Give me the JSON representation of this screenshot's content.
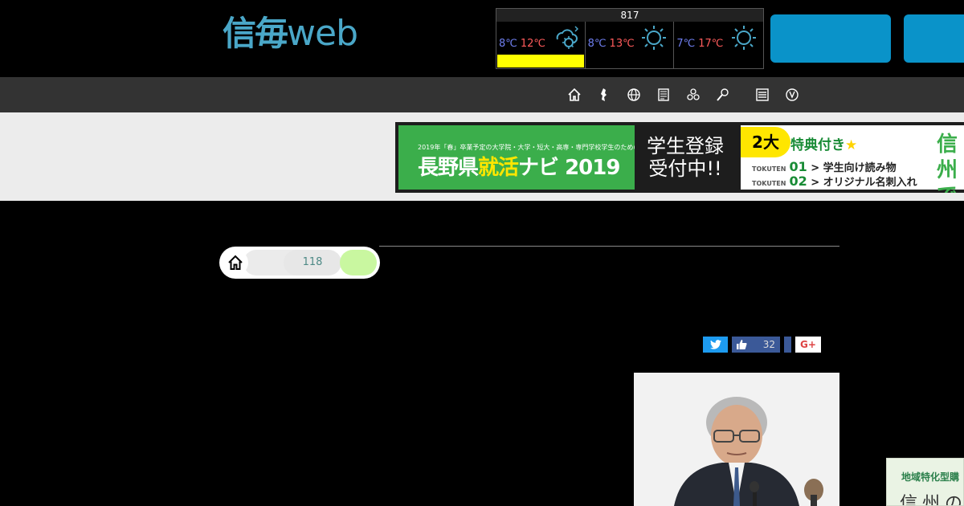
{
  "header": {
    "logo_kanji": "信毎",
    "logo_web": "web"
  },
  "weather": {
    "header_number": "817",
    "days": [
      {
        "min": "8℃",
        "max": "12℃",
        "icon": "cloudy-sun-icon"
      },
      {
        "min": "8℃",
        "max": "13℃",
        "icon": "sun-icon"
      },
      {
        "min": "7℃",
        "max": "17℃",
        "icon": "sun-icon"
      }
    ]
  },
  "nav": {
    "icons": [
      "home-icon",
      "nagano-map-icon",
      "globe-icon",
      "newspaper-icon",
      "community-icon",
      "sports-icon",
      "menu-list-icon",
      "recycle-icon"
    ]
  },
  "banner": {
    "green_sub": "2019年「春」卒業予定の大学院・大学・短大・高専・専門学校学生のための",
    "green_main_1": "長野県",
    "green_main_2": "就活",
    "green_main_3": "ナビ 2019",
    "mid_line1": "学生登録",
    "mid_line2": "受付中!!",
    "badge": "2大",
    "title": "特典付き",
    "tokuten1_label": "TOKUTEN",
    "tokuten1_num": "01",
    "tokuten1_text": "> 学生向け読み物",
    "tokuten2_label": "TOKUTEN",
    "tokuten2_num": "02",
    "tokuten2_text": "> オリジナル名刺入れ",
    "work_text": "信州で働く!!"
  },
  "breadcrumb": {
    "count": "118"
  },
  "social": {
    "facebook_count": "32",
    "gplus_label": "G+"
  },
  "side_ad": {
    "line1": "地域特化型購",
    "line2": "信州の"
  },
  "colors": {
    "logo": "#4aa7c8",
    "header_button": "#0a93c9",
    "navbar": "#333333",
    "temp_min": "#6f7ff0",
    "temp_max": "#ff5b5b",
    "weather_bar": "#ffff00",
    "banner_green": "#3bae4b"
  }
}
